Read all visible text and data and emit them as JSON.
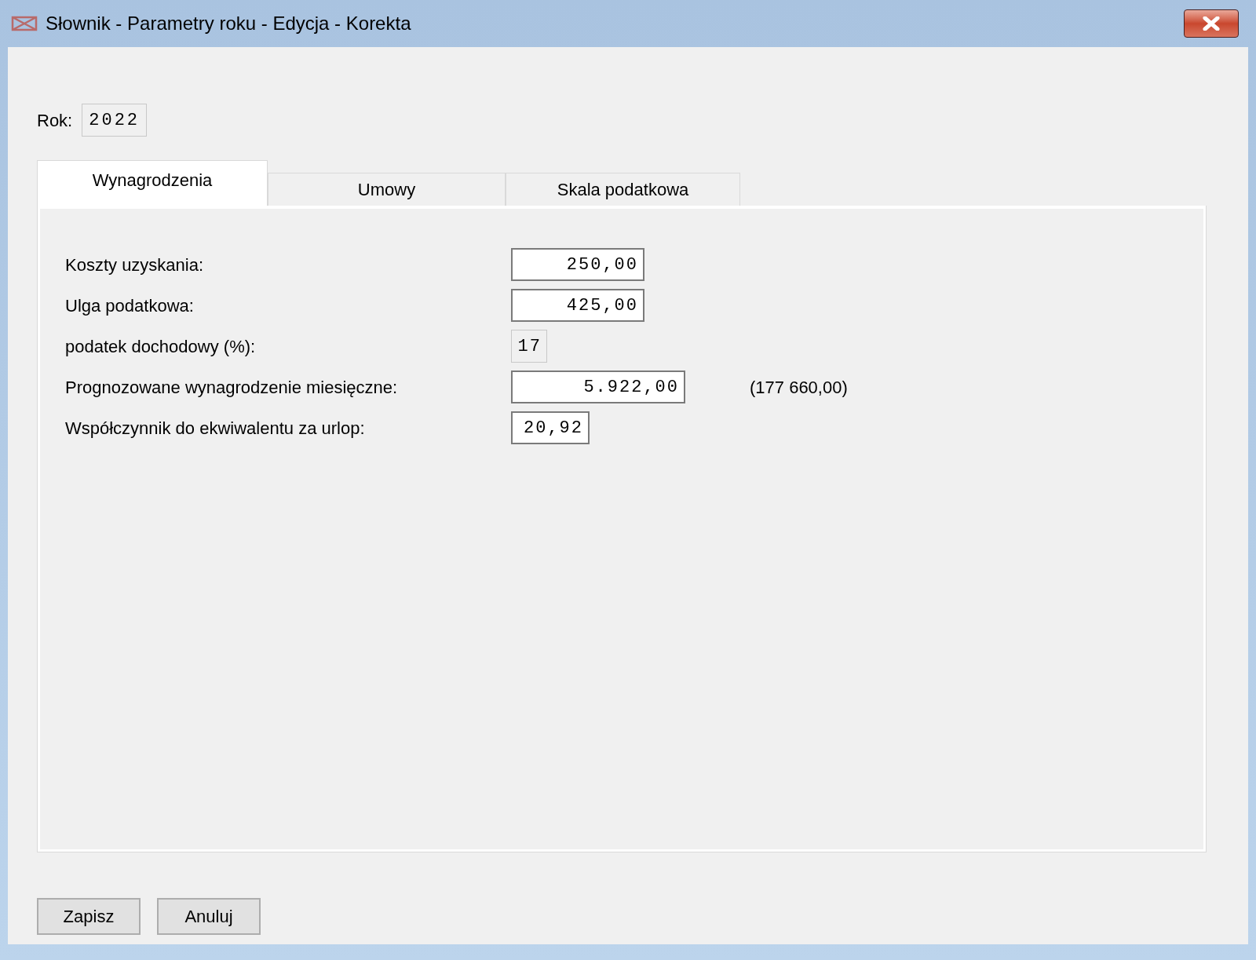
{
  "window": {
    "title": "Słownik - Parametry roku - Edycja - Korekta"
  },
  "year": {
    "label": "Rok:",
    "value": "2022",
    "readonly": true
  },
  "tabs": [
    {
      "label": "Wynagrodzenia",
      "selected": true
    },
    {
      "label": "Umowy",
      "selected": false
    },
    {
      "label": "Skala podatkowa",
      "selected": false
    }
  ],
  "fields": [
    {
      "label": "Koszty uzyskania:",
      "value": "250,00",
      "readonly": false
    },
    {
      "label": "Ulga podatkowa:",
      "value": "425,00",
      "readonly": false
    },
    {
      "label": "podatek dochodowy (%):",
      "value": "17",
      "readonly": true
    },
    {
      "label": "Prognozowane wynagrodzenie miesięczne:",
      "value": "5.922,00",
      "readonly": false,
      "note": "(177 660,00)"
    },
    {
      "label": "Współczynnik do ekwiwalentu za urlop:",
      "value": "20,92",
      "readonly": false
    }
  ],
  "buttons": [
    "Zapisz",
    "Anuluj"
  ]
}
